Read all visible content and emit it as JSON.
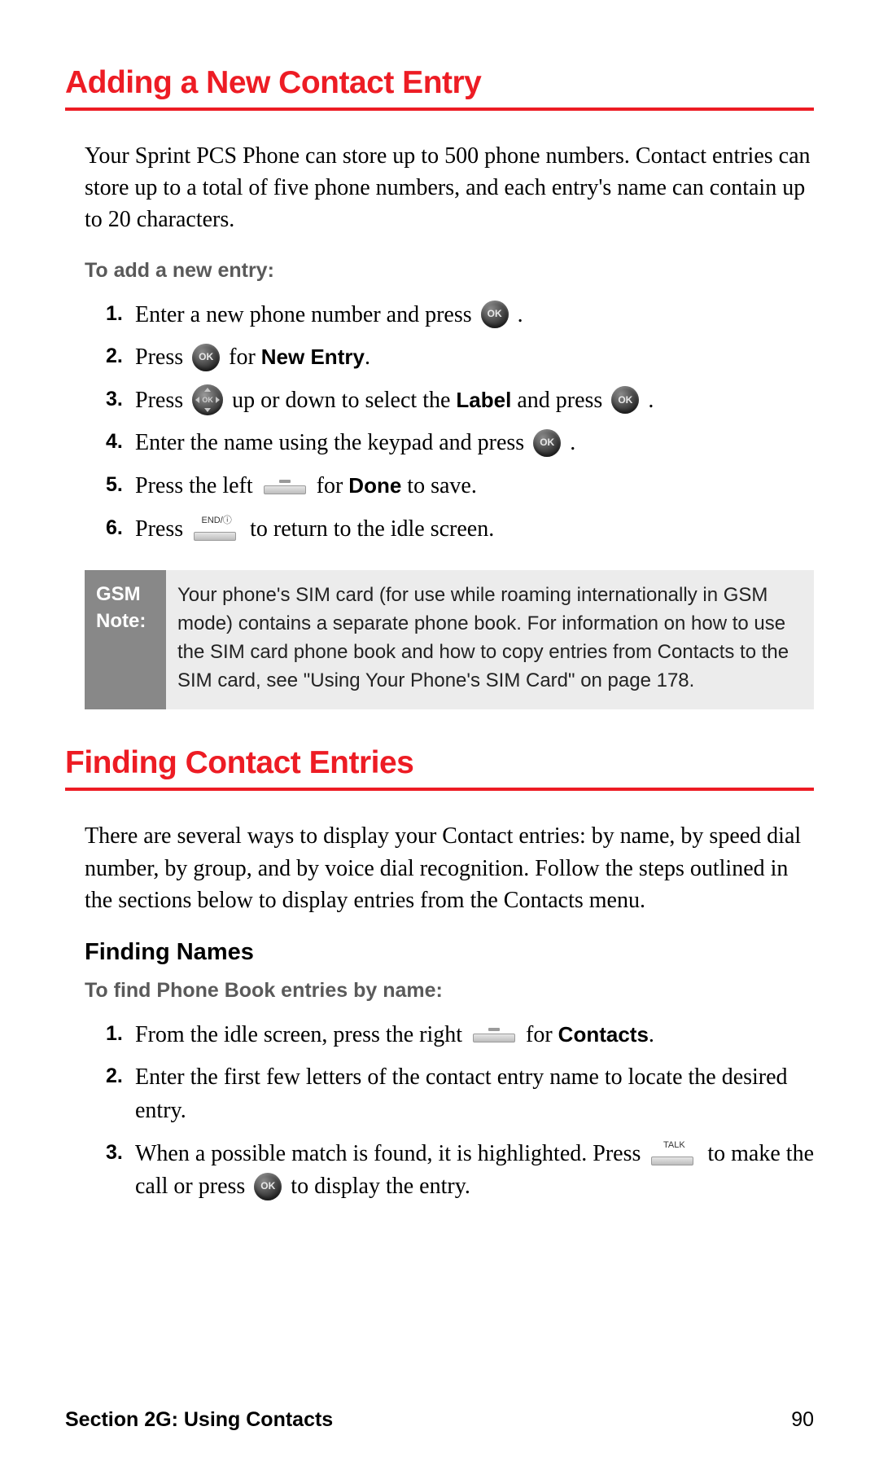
{
  "section1": {
    "title": "Adding a New Contact Entry",
    "intro": "Your Sprint PCS Phone can store up to 500 phone numbers. Contact entries can store up to a total of five phone numbers, and each entry's name can contain up to 20 characters.",
    "subhead": "To add a new entry:",
    "steps": {
      "s1_a": "Enter a new phone number and press ",
      "s1_b": ".",
      "s2_a": "Press ",
      "s2_b": " for ",
      "s2_bold": "New Entry",
      "s2_c": ".",
      "s3_a": "Press ",
      "s3_b": " up or down to select the ",
      "s3_bold": "Label",
      "s3_c": " and press ",
      "s3_d": ".",
      "s4_a": "Enter the name using the keypad and press ",
      "s4_b": ".",
      "s5_a": "Press the left ",
      "s5_b": " for ",
      "s5_bold": "Done",
      "s5_c": " to save.",
      "s6_a": "Press ",
      "s6_b": " to return to the idle screen."
    },
    "note_label_l1": "GSM",
    "note_label_l2": "Note:",
    "note_body": "Your phone's SIM card (for use while roaming internationally in GSM mode) contains a separate phone book. For information on how to use the SIM card phone book and how to copy entries from Contacts to the SIM card, see \"Using Your Phone's SIM Card\" on page 178."
  },
  "section2": {
    "title": "Finding Contact Entries",
    "intro": "There are several ways to display your Contact entries: by name, by speed dial number, by group, and by voice dial recognition. Follow the steps outlined in the sections below to display entries from the Contacts menu.",
    "sub_title": "Finding Names",
    "subhead": "To find Phone Book entries by name:",
    "steps": {
      "s1_a": "From the idle screen, press the right ",
      "s1_b": " for ",
      "s1_bold": "Contacts",
      "s1_c": ".",
      "s2": "Enter the first few letters of the contact entry name to locate the desired entry.",
      "s3_a": "When a possible match is found, it is highlighted. Press ",
      "s3_b": " to make the call or press ",
      "s3_c": " to display the entry."
    }
  },
  "buttons": {
    "ok": "OK",
    "nav": "OK",
    "end_label": "END/ⓘ",
    "talk_label": "TALK"
  },
  "footer": {
    "section": "Section 2G: Using Contacts",
    "page": "90"
  },
  "nums": {
    "n1": "1.",
    "n2": "2.",
    "n3": "3.",
    "n4": "4.",
    "n5": "5.",
    "n6": "6."
  }
}
